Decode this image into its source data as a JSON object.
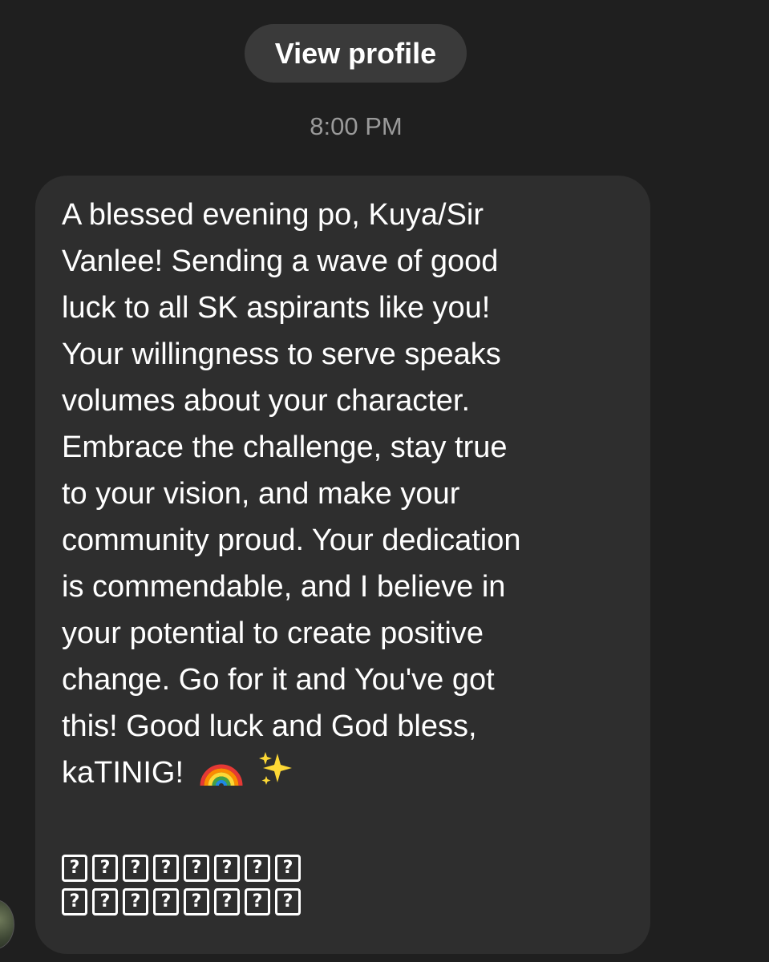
{
  "header": {
    "view_profile_label": "View profile"
  },
  "timestamp": "8:00 PM",
  "message": {
    "lines": [
      "A blessed evening po, Kuya/Sir",
      "Vanlee! Sending a wave of good",
      "luck to all SK aspirants like you!",
      "Your willingness to serve speaks",
      "volumes about your character.",
      "Embrace the challenge, stay true",
      "to your vision, and make your",
      "community proud. Your dedication",
      "is commendable, and I believe in",
      "your potential to create positive",
      "change. Go for it and You've got",
      "this! Good luck and God bless,",
      "kaTINIG!"
    ],
    "emojis": [
      "rainbow-icon",
      "sparkles-icon"
    ],
    "unrendered_glyphs": {
      "row1": [
        "?",
        "?",
        "?",
        "?",
        "?",
        "?",
        "?",
        "?"
      ],
      "row2": [
        "?",
        "?",
        "?",
        "?",
        "?",
        "?",
        "?",
        "?"
      ]
    }
  },
  "colors": {
    "background": "#1f1f1f",
    "bubble": "#2e2e2e",
    "button": "#3a3a3a",
    "timestamp": "#9a9a9a"
  }
}
